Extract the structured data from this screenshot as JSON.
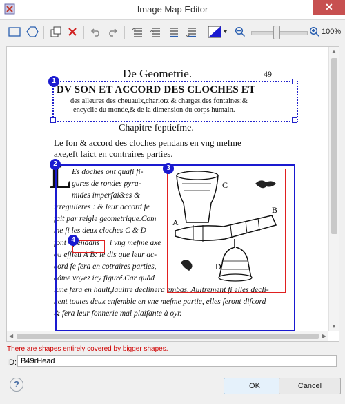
{
  "window": {
    "title": "Image Map Editor"
  },
  "toolbar": {
    "zoom_label": "100%",
    "zoom_level": 0.5,
    "color_accent": "#1a1ad0"
  },
  "document": {
    "header_title": "De  Geometrie.",
    "page_number": "49",
    "heading_line1": "DV SON ET ACCORD DES CLOCHES ET",
    "heading_line2": "des alleures des cheuaulx,chariotz & charges,des fontaines:&",
    "heading_line3": "encyclie du monde,& de la dimension du corps humain.",
    "chapter": "Chapitre feptiefme.",
    "intro_line1": "Le fon & accord des cloches pendans en vng mefme",
    "intro_line2": "axe,eft faict en contraires parties.",
    "body_lines": [
      "Es doches ont quafi fi-",
      "gures de rondes pyra-",
      "mides imperfai&es &",
      "irregulieres : & leur accord fe",
      "fait par reigle geometrique.Com",
      "me fi les deux cloches C & D",
      "font",
      "pendans",
      "i vng mefme axe",
      "ou effieu A B: ie dis que leur ac-",
      "cord fe fera en cotraires parties,",
      "cóme voyez icy figuré.Car quād",
      "lune fera en hault,laultre declinera embas. Aultrement fi elles decli-",
      "nent toutes deux enfemble en vne mefme partie, elles feront difcord",
      "& fera leur fonnerie mal plaifante à oyr."
    ],
    "illustration_labels": [
      "C",
      "A",
      "B",
      "D"
    ]
  },
  "shapes": [
    {
      "number": "1",
      "style": "dotted",
      "color": "#1a1ad0"
    },
    {
      "number": "2",
      "style": "solid",
      "color": "#1a1ad0"
    },
    {
      "number": "3",
      "style": "solid",
      "color": "#e02020"
    },
    {
      "number": "4",
      "style": "solid",
      "color": "#e02020"
    }
  ],
  "status": {
    "warning": "There are shapes entirely covered by bigger shapes.",
    "warning_color": "#d00000"
  },
  "form": {
    "id_label": "ID:",
    "id_value": "B49rHead"
  },
  "buttons": {
    "ok": "OK",
    "cancel": "Cancel",
    "help": "?"
  }
}
